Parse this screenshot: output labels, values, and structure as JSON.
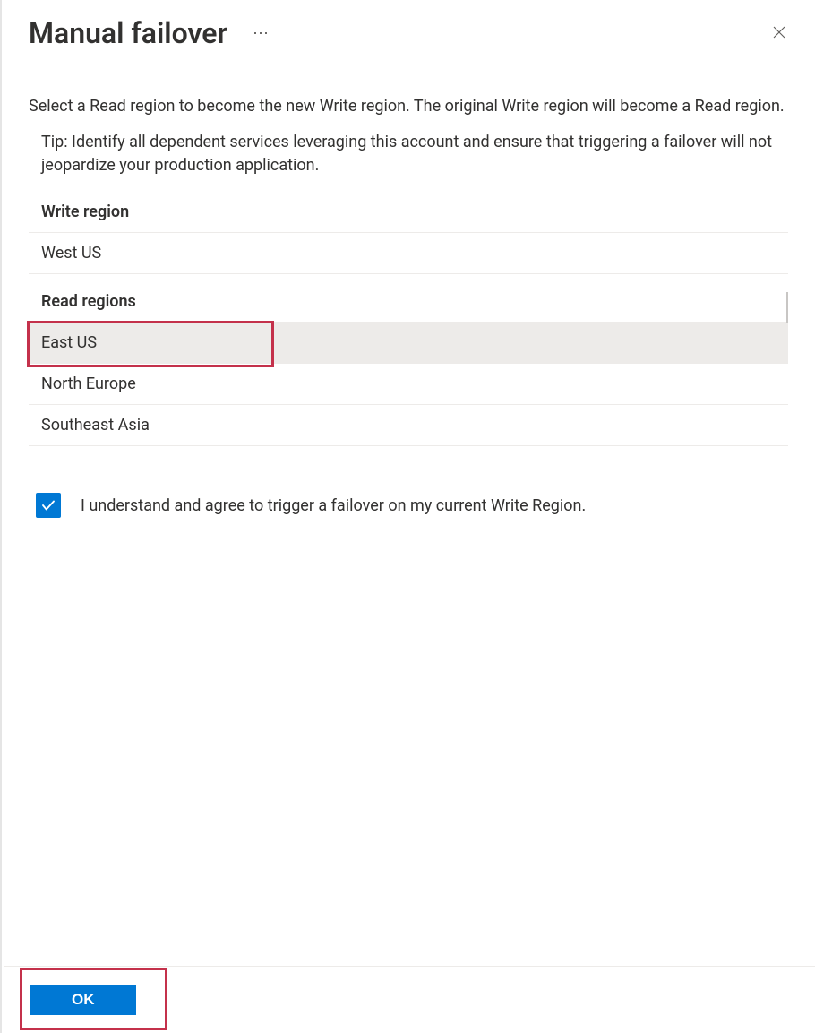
{
  "header": {
    "title": "Manual failover",
    "more_label": "⋯"
  },
  "main": {
    "description": "Select a Read region to become the new Write region. The original Write region will become a Read region.",
    "tip": "Tip: Identify all dependent services leveraging this account and ensure that triggering a failover will not jeopardize your production application.",
    "write_region_header": "Write region",
    "write_region_value": "West US",
    "read_regions_header": "Read regions",
    "read_regions": [
      {
        "label": "East US",
        "selected": true
      },
      {
        "label": "North Europe",
        "selected": false
      },
      {
        "label": "Southeast Asia",
        "selected": false
      }
    ],
    "consent": {
      "checked": true,
      "label": "I understand and agree to trigger a failover on my current Write Region."
    }
  },
  "footer": {
    "ok_label": "OK"
  }
}
